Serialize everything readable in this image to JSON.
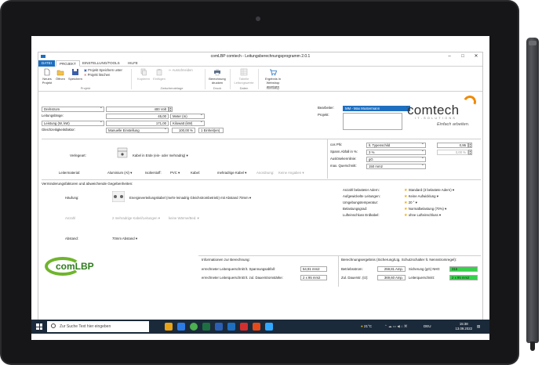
{
  "window": {
    "title": "comLBP  comtech - Leitungsberechnungsprogramm 2.0.1",
    "minimize": "–",
    "maximize": "□",
    "close": "✕"
  },
  "ribbon_tabs": [
    "DATEI",
    "PROJEKT",
    "EINSTELLUNG/TOOLS",
    "HILFE"
  ],
  "ribbon": {
    "new_project": "Neues Projekt",
    "open": "Öffnen",
    "save": "Speichern",
    "save_as": "Projekt Speichern unter",
    "delete_project": "Projekt löschen",
    "group_project": "Projekt",
    "copy": "Kopieren",
    "paste": "Einfügen",
    "cut": "Ausschneiden",
    "group_clipboard": "Zwischenablage",
    "print_calc": "Berechnung drucken",
    "group_print": "Druck",
    "table_values": "Tabelle Leitungswerte",
    "group_data": "Daten",
    "webshop": "Ergebnis in Webshop anzeigen",
    "group_webshop": "Webshop"
  },
  "inputs": {
    "current_type": "Drehstrom",
    "voltage": "400 Volt",
    "length_label": "Leitungslänge:",
    "length_value": "45,00",
    "length_unit": "Meter (m)",
    "power_select": "Leistung (W, kW)",
    "power_value": "171,00",
    "power_unit": "Kilowatt (kW)",
    "simult_label": "Gleichzeitigkeitsfaktor:",
    "simult_mode": "Manuelle Einstellung",
    "simult_percent": "100,00 %",
    "simult_units": "1 Einheit(en)"
  },
  "editor": {
    "editor_label": "Bearbeiter:",
    "editor_value": "MM - Max Mustermann",
    "project_label": "Projekt:"
  },
  "logo": {
    "word": "comtech",
    "sub": "IT-SOLUTIONS",
    "tagline": "Einfach arbeiten."
  },
  "install": {
    "laying_label": "Verlegeart:",
    "laying_value": "Kabel in Erde (ein- oder mehradrig)",
    "conductor_label": "Leitermaterial:",
    "conductor_value": "Aluminium (Al)",
    "insulation_label": "Isolierstoff:",
    "insulation_value": "PVC",
    "cable_label": "Kabel:",
    "cable_value": "mehradrige Kabel",
    "arrangement_label": "Anordnung:",
    "arrangement_value": "Keine Angaben"
  },
  "electric": {
    "cosphi_label": "cos Phi:",
    "cosphi_mode": "lt. Typenschild",
    "cosphi_value": "0,95",
    "drop_label": "Spann.Abfall in %:",
    "drop_mode": "3 %",
    "drop_value": "3,00 %",
    "trip_label": "Auslösekennlinie:",
    "trip_value": "gG",
    "maxcs_label": "max. Querschnitt:",
    "maxcs_value": "150 mm2"
  },
  "reduction": {
    "title": "Verminderungsfaktoren und abweichende Gegebenheiten:",
    "grouping_label": "Häufung:",
    "grouping_value": "Energieverteilungskabel (mehr-/einadrig Gleichstrombetrieb) mit Abstand 70mm",
    "count_label": "Anzahl",
    "count_value": "2 mehradrige Kabel/Leitungen",
    "count_value2": "keine Wärme/Bed.",
    "distance_label": "Abstand:",
    "distance_value": "70mm Abstand",
    "loaded_label": "Anzahl belasteter Adern:",
    "loaded_value": "Standard (3 belastete Adern)",
    "coil_label": "Aufgewickelte Leitungen:",
    "coil_value": "Keine Aufwicklung",
    "ambient_label": "Umgebungstemperatur:",
    "ambient_value": "20 °",
    "load_label": "Belastungsgrad:",
    "load_value": "Normalbelastung (70%)",
    "airgap_label": "Lufteinschluss Erdkabel:",
    "airgap_value": "ohne Lufteinschluss"
  },
  "info": {
    "title": "Informationen zur Berechnung:",
    "drop_cs_label": "errechneter Leiterquerschnitt lt. Spannungsabfall:",
    "drop_cs_value": "54,91 mm2",
    "curr_cs_label": "errechneter Leiterquerschnitt lt. zul. Dauerstromstärke:",
    "curr_cs_value": "2 x 95 mm2"
  },
  "result": {
    "title": "Berechnungsergebnis (Sicherung/Ltg. Schutzschalter lt. Nennstromregel):",
    "op_current_label": "Betriebsstrom:",
    "op_current_value": "259,81 Amp.",
    "fuse_label": "Sicherung (gG) NH0:",
    "fuse_value": "315",
    "cont_current_label": "Zul. Dauerstr. (Iz):",
    "cont_current_value": "369,60 Amp.",
    "cs_label": "Leiterquerschnitt:",
    "cs_value": "2 x 95 mm2"
  },
  "brand_logo": "comLBP",
  "taskbar": {
    "search_placeholder": "Zur Suche Text hier eingeben",
    "weather": "21°C",
    "lang": "DEU",
    "time": "15:38",
    "date": "13.09.2022"
  },
  "colors": {
    "accent": "#1e6fc0",
    "result_green": "#35d14a",
    "brand_orange": "#f08a00",
    "brand_green": "#6fb52c"
  }
}
